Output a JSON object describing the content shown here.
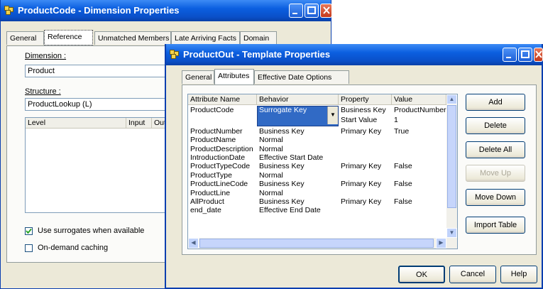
{
  "back_window": {
    "title": "ProductCode - Dimension Properties",
    "tabs": [
      "General",
      "Reference",
      "Unmatched Members",
      "Late Arriving Facts",
      "Domain"
    ],
    "selected_tab": "Reference",
    "dimension_label": "Dimension :",
    "dimension_value": "Product",
    "structure_label": "Structure :",
    "structure_value": "ProductLookup (L)",
    "level_columns": [
      "Level",
      "Input",
      "Out"
    ],
    "use_surrogates_label": "Use surrogates when available",
    "use_surrogates_checked": true,
    "on_demand_label": "On-demand caching",
    "on_demand_checked": false
  },
  "front_window": {
    "title": "ProductOut - Template Properties",
    "tabs": [
      "General",
      "Attributes",
      "Effective Date Options"
    ],
    "selected_tab": "Attributes",
    "columns": [
      "Attribute Name",
      "Behavior",
      "Property",
      "Value"
    ],
    "rows": [
      {
        "name": "ProductCode",
        "behavior": "Surrogate Key",
        "property": "Business Key",
        "value": "ProductNumber",
        "property2": "Start Value",
        "value2": "1",
        "selected": true
      },
      {
        "name": "ProductNumber",
        "behavior": "Business Key",
        "property": "Primary Key",
        "value": "True"
      },
      {
        "name": "ProductName",
        "behavior": "Normal",
        "property": "",
        "value": ""
      },
      {
        "name": "ProductDescription",
        "behavior": "Normal",
        "property": "",
        "value": ""
      },
      {
        "name": "IntroductionDate",
        "behavior": "Effective Start Date",
        "property": "",
        "value": ""
      },
      {
        "name": "ProductTypeCode",
        "behavior": "Business Key",
        "property": "Primary Key",
        "value": "False"
      },
      {
        "name": "ProductType",
        "behavior": "Normal",
        "property": "",
        "value": ""
      },
      {
        "name": "ProductLineCode",
        "behavior": "Business Key",
        "property": "Primary Key",
        "value": "False"
      },
      {
        "name": "ProductLine",
        "behavior": "Normal",
        "property": "",
        "value": ""
      },
      {
        "name": "AllProduct",
        "behavior": "Business Key",
        "property": "Primary Key",
        "value": "False"
      },
      {
        "name": "end_date",
        "behavior": "Effective End Date",
        "property": "",
        "value": ""
      }
    ],
    "side_buttons": {
      "add": "Add",
      "delete": "Delete",
      "delete_all": "Delete All",
      "move_up": "Move Up",
      "move_down": "Move Down",
      "import_table": "Import Table"
    },
    "footer_buttons": {
      "ok": "OK",
      "cancel": "Cancel",
      "help": "Help"
    }
  },
  "colors": {
    "titlebar": "#0b5fe0",
    "dialog_bg": "#ece9d8",
    "selection": "#316ac5"
  }
}
